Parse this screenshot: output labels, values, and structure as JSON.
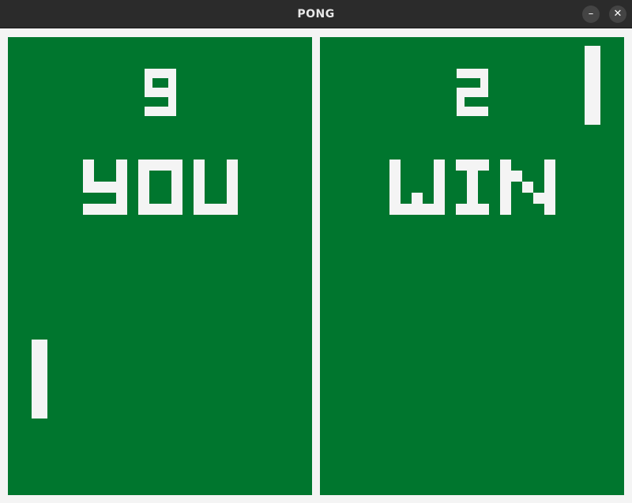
{
  "window": {
    "title": "PONG",
    "minimize_icon": "minimize-icon",
    "minimize_glyph": "–",
    "close_icon": "close-icon",
    "close_glyph": "✕"
  },
  "game": {
    "player_left": {
      "score": "9",
      "message": "YOU"
    },
    "player_right": {
      "score": "2",
      "message": "WIN"
    }
  },
  "colors": {
    "court": "#00762e",
    "foreground": "#f4f4f4",
    "titlebar": "#2b2b2b"
  }
}
